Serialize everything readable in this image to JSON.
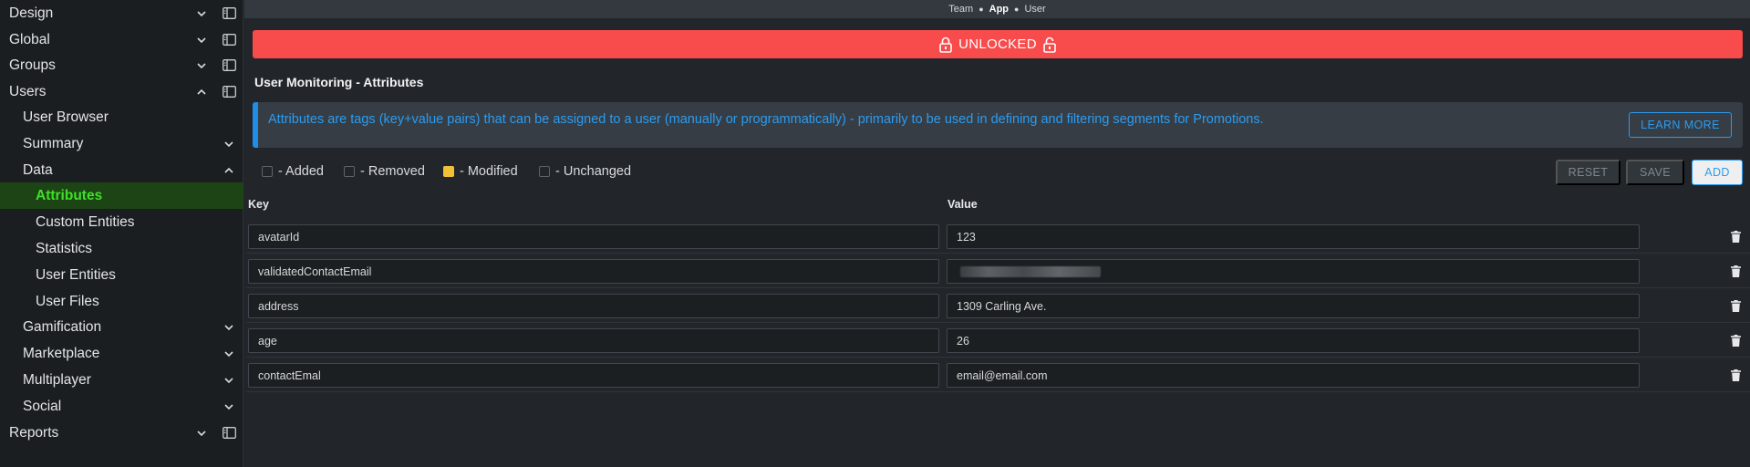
{
  "sidebar": {
    "items": [
      {
        "label": "Design",
        "level": 0,
        "expanded": false,
        "panel_icon": true
      },
      {
        "label": "Global",
        "level": 0,
        "expanded": false,
        "panel_icon": true
      },
      {
        "label": "Groups",
        "level": 0,
        "expanded": false,
        "panel_icon": true
      },
      {
        "label": "Users",
        "level": 0,
        "expanded": true,
        "panel_icon": true
      },
      {
        "label": "User Browser",
        "level": 1,
        "expanded": null
      },
      {
        "label": "Summary",
        "level": 1,
        "expanded": false
      },
      {
        "label": "Data",
        "level": 1,
        "expanded": true
      },
      {
        "label": "Attributes",
        "level": 2,
        "active": true
      },
      {
        "label": "Custom Entities",
        "level": 2
      },
      {
        "label": "Statistics",
        "level": 2
      },
      {
        "label": "User Entities",
        "level": 2
      },
      {
        "label": "User Files",
        "level": 2
      },
      {
        "label": "Gamification",
        "level": 1,
        "expanded": false
      },
      {
        "label": "Marketplace",
        "level": 1,
        "expanded": false
      },
      {
        "label": "Multiplayer",
        "level": 1,
        "expanded": false
      },
      {
        "label": "Social",
        "level": 1,
        "expanded": false
      },
      {
        "label": "Reports",
        "level": 0,
        "expanded": false,
        "panel_icon": true
      }
    ]
  },
  "breadcrumb": {
    "team": "Team",
    "app": "App",
    "user": "User"
  },
  "banner": {
    "label": "UNLOCKED",
    "icon": "lock-open-icon",
    "color": "#f84b4b"
  },
  "page_title": "User Monitoring - Attributes",
  "info": {
    "text": "Attributes are tags (key+value pairs) that can be assigned to a user (manually or programmatically) - primarily to be used in defining and filtering segments for Promotions.",
    "learn_more": "LEARN MORE"
  },
  "legend": {
    "added": "- Added",
    "removed": "- Removed",
    "modified": "- Modified",
    "unchanged": "- Unchanged",
    "modified_color": "#f2c037"
  },
  "actions": {
    "reset": "RESET",
    "save": "SAVE",
    "add": "ADD"
  },
  "table": {
    "headers": {
      "key": "Key",
      "value": "Value"
    },
    "rows": [
      {
        "key": "avatarId",
        "value": "123"
      },
      {
        "key": "validatedContactEmail",
        "value": "",
        "redacted": true
      },
      {
        "key": "address",
        "value": "1309 Carling Ave."
      },
      {
        "key": "age",
        "value": "26"
      },
      {
        "key": "contactEmal",
        "value": "email@email.com"
      }
    ]
  },
  "colors": {
    "accent": "#2a9cf2",
    "active_nav": "#3fe02a",
    "active_nav_bg": "#1c4414"
  }
}
